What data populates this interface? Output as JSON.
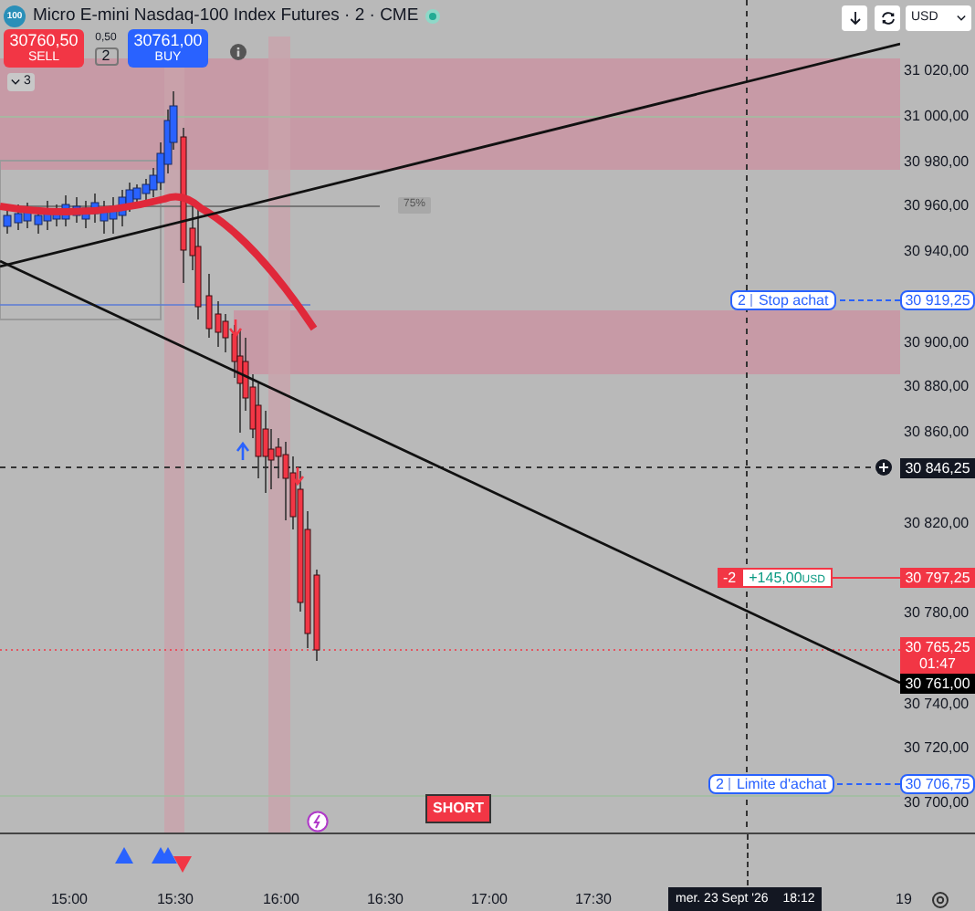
{
  "header": {
    "symbol_badge": "100",
    "title": "Micro E-mini Nasdaq-100 Index Futures · 2 · CME",
    "connected": true
  },
  "trade_bar": {
    "sell_price": "30760,50",
    "sell_label": "SELL",
    "spread": "0,50",
    "quantity": "2",
    "buy_price": "30761,00",
    "buy_label": "BUY"
  },
  "toolbar": {
    "currency": "USD"
  },
  "indicators_toggle": "3",
  "percent_tag": "75%",
  "order_lines": [
    {
      "kind": "stop",
      "quantity": "2",
      "label": "Stop achat"
    },
    {
      "kind": "position",
      "quantity": "-2",
      "pnl": "+145,00",
      "currency": "USD"
    },
    {
      "kind": "limit",
      "quantity": "2",
      "label": "Limite d'achat"
    }
  ],
  "price_axis": {
    "ticks": [
      "31 020,00",
      "31 000,00",
      "30 980,00",
      "30 960,00",
      "30 940,00",
      "30 900,00",
      "30 880,00",
      "30 860,00",
      "30 820,00",
      "30 780,00",
      "30 740,00",
      "30 720,00",
      "30 700,00"
    ],
    "labels": [
      {
        "kind": "order",
        "text": "30 919,25"
      },
      {
        "kind": "crosshair",
        "text": "30 846,25"
      },
      {
        "kind": "position",
        "text": "30 797,25"
      },
      {
        "kind": "last",
        "text": "30 765,25",
        "countdown": "01:47"
      },
      {
        "kind": "bid",
        "text": "30 761,00"
      },
      {
        "kind": "order",
        "text": "30 706,75"
      }
    ]
  },
  "signal": {
    "label": "SHORT"
  },
  "time_axis": {
    "ticks": [
      "15:00",
      "15:30",
      "16:00",
      "16:30",
      "17:00",
      "17:30",
      "19"
    ],
    "crosshair_date": "mer. 23 Sept '26",
    "crosshair_time": "18:12"
  }
}
